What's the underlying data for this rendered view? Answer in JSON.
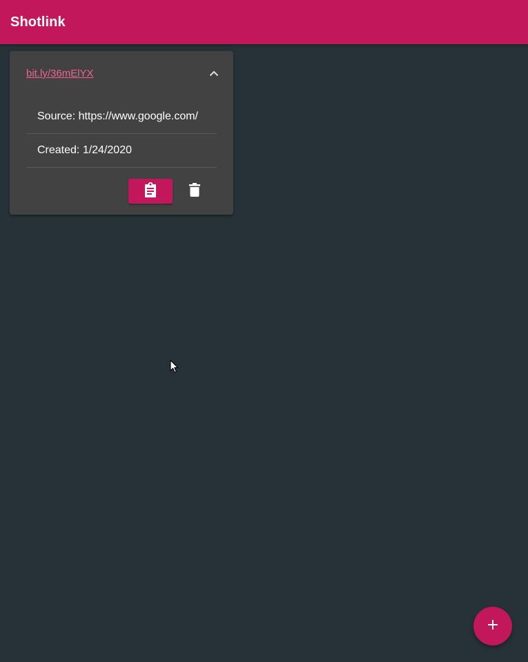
{
  "app_bar": {
    "title": "Shotlink",
    "color": "#c2185b"
  },
  "link_card": {
    "short_url": "bit.ly/36mElYX",
    "expanded": true,
    "toggle_icon": "chevron-up-icon",
    "details": [
      {
        "text": "Source: https://www.google.com/"
      },
      {
        "text": "Created: 1/24/2020"
      }
    ],
    "copy_icon": "clipboard-icon",
    "delete_icon": "trash-icon"
  },
  "fab": {
    "icon": "plus-icon",
    "label": "+"
  },
  "colors": {
    "background": "#263238",
    "card": "#424242",
    "accent": "#c2185b",
    "link": "#f06292"
  }
}
